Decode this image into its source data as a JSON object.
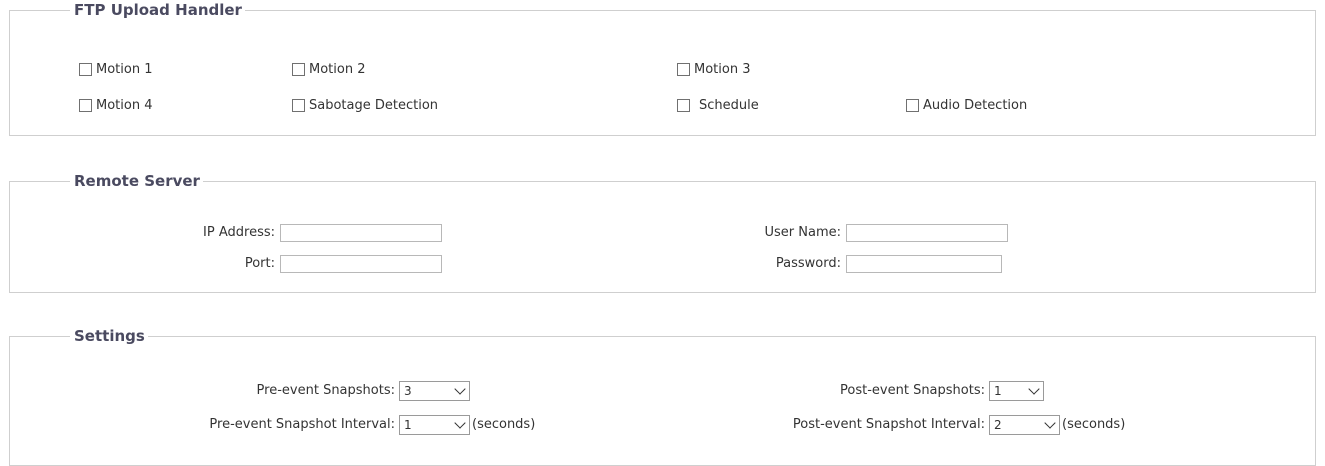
{
  "ftp_upload_handler": {
    "title": "FTP Upload Handler",
    "checkboxes": [
      {
        "label": "Motion 1",
        "checked": false
      },
      {
        "label": "Motion 2",
        "checked": false
      },
      {
        "label": "Motion 3",
        "checked": false
      },
      {
        "label": "Motion 4",
        "checked": false
      },
      {
        "label": "Sabotage Detection",
        "checked": false
      },
      {
        "label": "Schedule",
        "checked": false
      },
      {
        "label": "Audio Detection",
        "checked": false
      }
    ]
  },
  "remote_server": {
    "title": "Remote Server",
    "ip_address_label": "IP Address:",
    "ip_address_value": "",
    "port_label": "Port:",
    "port_value": "",
    "user_name_label": "User Name:",
    "user_name_value": "",
    "password_label": "Password:",
    "password_value": ""
  },
  "settings": {
    "title": "Settings",
    "pre_event_snapshots_label": "Pre-event Snapshots:",
    "pre_event_snapshots_value": "3",
    "pre_event_interval_label": "Pre-event Snapshot Interval:",
    "pre_event_interval_value": "1",
    "post_event_snapshots_label": "Post-event Snapshots:",
    "post_event_snapshots_value": "1",
    "post_event_interval_label": "Post-event Snapshot Interval:",
    "post_event_interval_value": "2",
    "seconds_unit": "(seconds)"
  }
}
